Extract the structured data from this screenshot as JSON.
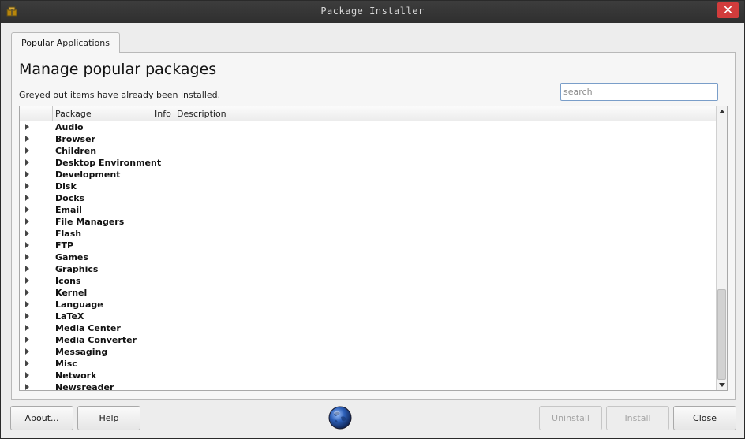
{
  "window": {
    "title": "Package Installer",
    "close_glyph": "✕",
    "app_icon": "package-icon"
  },
  "tabs": [
    {
      "label": "Popular Applications",
      "active": true
    }
  ],
  "main": {
    "heading": "Manage popular packages",
    "subtext": "Greyed out items have already been installed.",
    "search": {
      "value": "",
      "placeholder": "search"
    }
  },
  "tree": {
    "columns": [
      "",
      "",
      "Package",
      "Info",
      "Description"
    ],
    "rows": [
      {
        "label": "Audio"
      },
      {
        "label": "Browser"
      },
      {
        "label": "Children"
      },
      {
        "label": "Desktop Environment"
      },
      {
        "label": "Development"
      },
      {
        "label": "Disk"
      },
      {
        "label": "Docks"
      },
      {
        "label": "Email"
      },
      {
        "label": "File Managers"
      },
      {
        "label": "Flash"
      },
      {
        "label": "FTP"
      },
      {
        "label": "Games"
      },
      {
        "label": "Graphics"
      },
      {
        "label": "Icons"
      },
      {
        "label": "Kernel"
      },
      {
        "label": "Language"
      },
      {
        "label": "LaTeX"
      },
      {
        "label": "Media Center"
      },
      {
        "label": "Media Converter"
      },
      {
        "label": "Messaging"
      },
      {
        "label": "Misc"
      },
      {
        "label": "Network"
      },
      {
        "label": "Newsreader"
      }
    ]
  },
  "footer": {
    "about_label": "About...",
    "help_label": "Help",
    "uninstall_label": "Uninstall",
    "install_label": "Install",
    "close_label": "Close",
    "uninstall_enabled": false,
    "install_enabled": false,
    "center_icon": "globe-icon"
  },
  "colors": {
    "titlebar": "#333333",
    "close_button": "#d23c3c",
    "search_focus_border": "#7a9ec9",
    "disabled_text": "#a5a5a5"
  }
}
